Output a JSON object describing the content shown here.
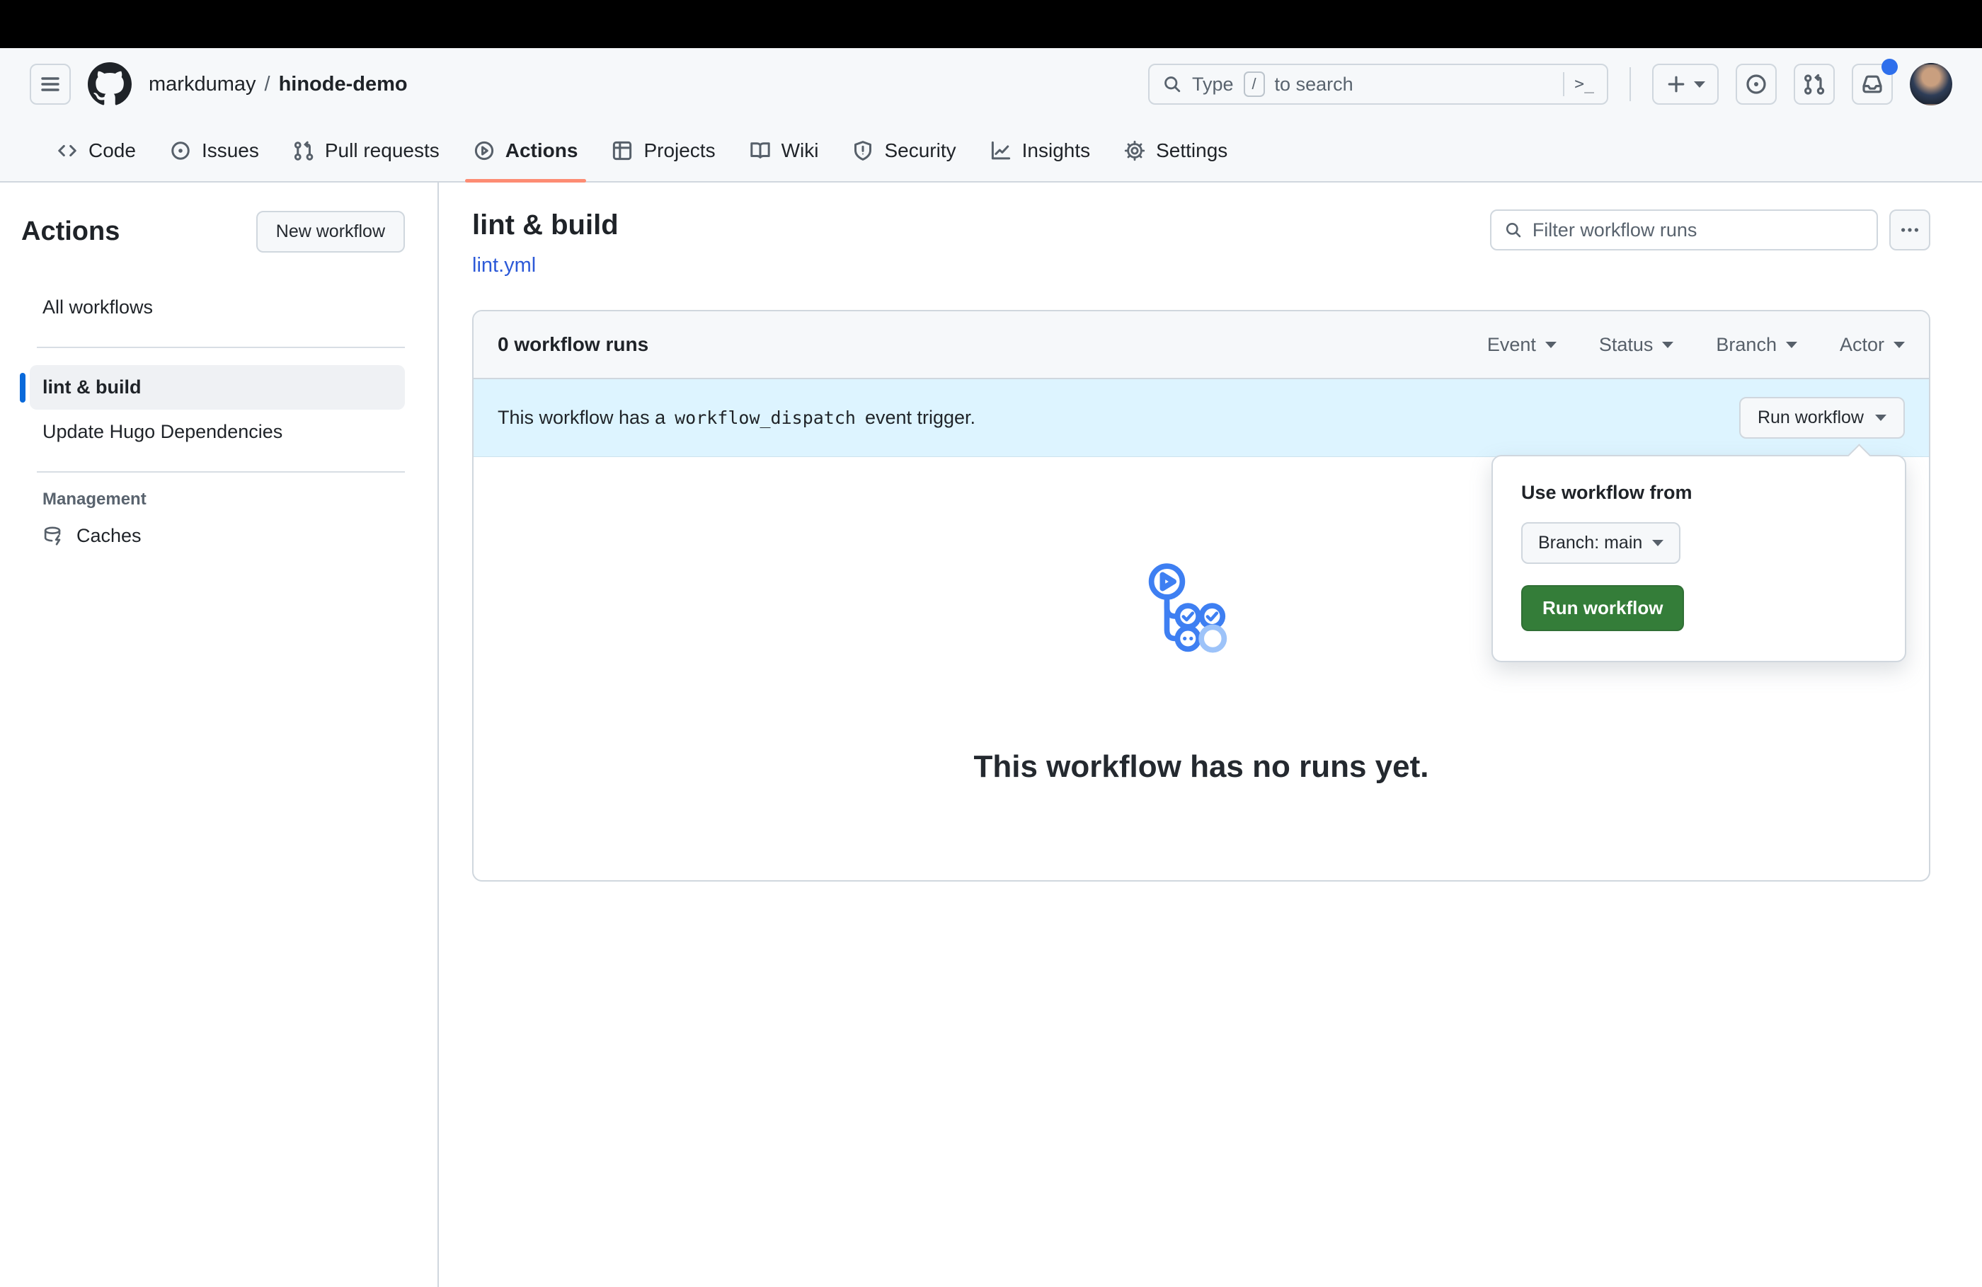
{
  "colors": {
    "accent_blue": "#0969da",
    "link_blue": "#2d5ad8",
    "banner_bg": "#ddf4ff",
    "success_green": "#347d39",
    "tab_underline_orange": "#fd8c73",
    "notification_dot": "#2e6fec"
  },
  "header": {
    "breadcrumb": {
      "owner": "markdumay",
      "separator": "/",
      "repo": "hinode-demo"
    },
    "search": {
      "prefix": "Type",
      "slash_key": "/",
      "suffix": "to search",
      "terminal_hint": ">_"
    }
  },
  "nav": {
    "active_tab": "Actions",
    "tabs": [
      {
        "label": "Code"
      },
      {
        "label": "Issues"
      },
      {
        "label": "Pull requests"
      },
      {
        "label": "Actions"
      },
      {
        "label": "Projects"
      },
      {
        "label": "Wiki"
      },
      {
        "label": "Security"
      },
      {
        "label": "Insights"
      },
      {
        "label": "Settings"
      }
    ]
  },
  "sidebar": {
    "title": "Actions",
    "new_workflow_button": "New workflow",
    "selected_item": "lint & build",
    "items": [
      {
        "label": "All workflows"
      },
      {
        "label": "lint & build"
      },
      {
        "label": "Update Hugo Dependencies"
      }
    ],
    "management_heading": "Management",
    "management_items": [
      {
        "label": "Caches"
      }
    ]
  },
  "main": {
    "workflow_title": "lint & build",
    "workflow_file": "lint.yml",
    "filter_placeholder": "Filter workflow runs",
    "runs_count_label": "0 workflow runs",
    "filters": [
      {
        "label": "Event"
      },
      {
        "label": "Status"
      },
      {
        "label": "Branch"
      },
      {
        "label": "Actor"
      }
    ],
    "banner": {
      "text_before_code": "This workflow has a",
      "code": "workflow_dispatch",
      "text_after_code": "event trigger.",
      "run_workflow_button": "Run workflow"
    },
    "empty_state": {
      "heading": "This workflow has no runs yet."
    },
    "run_popover": {
      "title": "Use workflow from",
      "branch_button": "Branch: main",
      "run_button": "Run workflow"
    }
  }
}
